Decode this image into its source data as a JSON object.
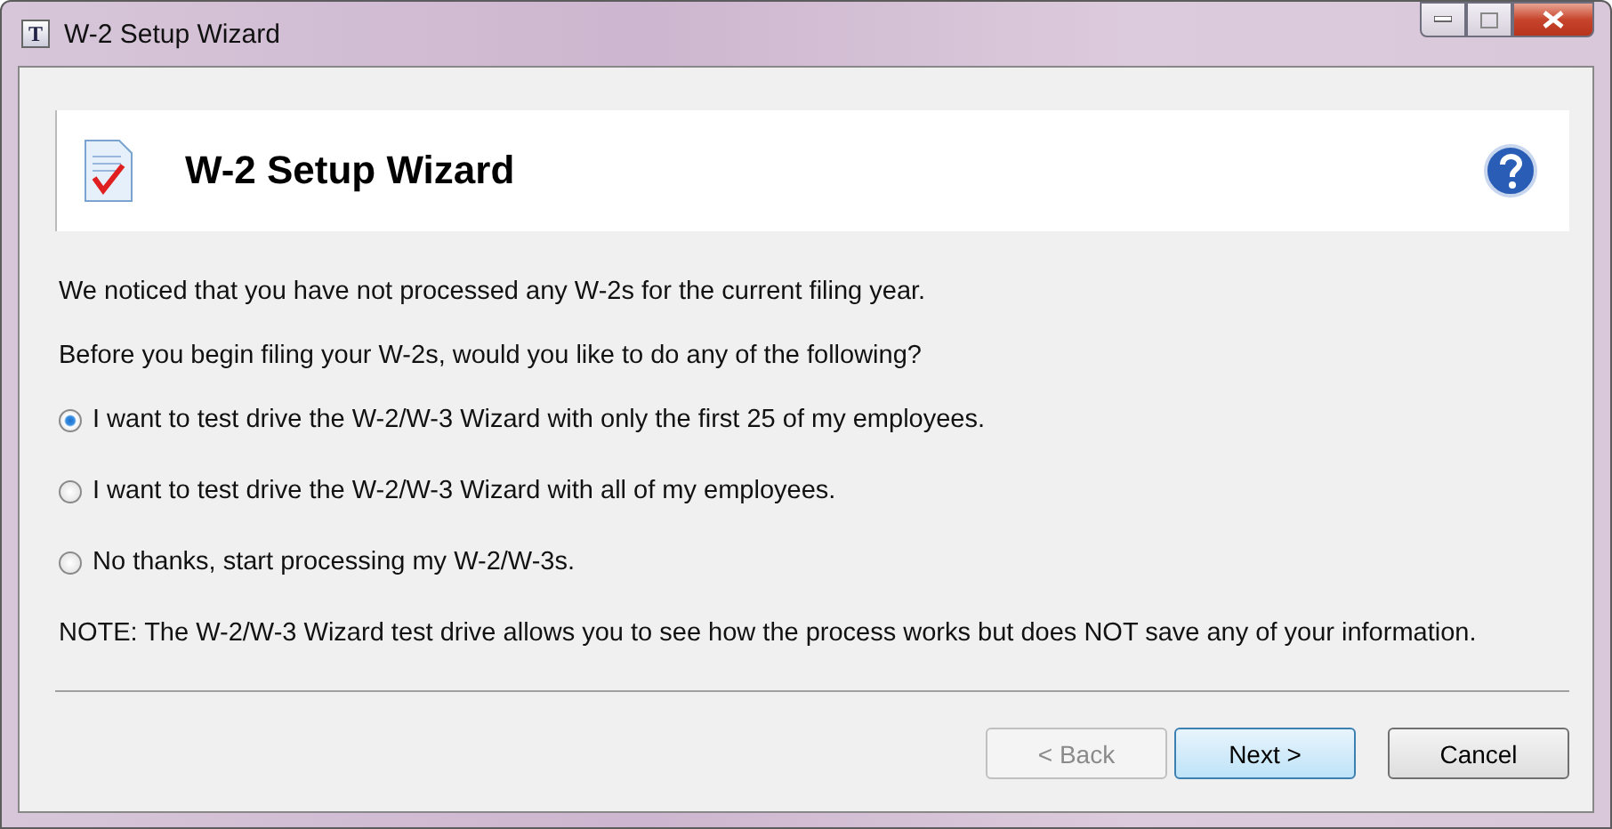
{
  "window": {
    "title": "W-2 Setup Wizard",
    "app_icon_letter": "T"
  },
  "header": {
    "title": "W-2 Setup Wizard"
  },
  "intro": "We noticed that you have not processed any W-2s for the current filing year.",
  "question": "Before you begin filing your W-2s, would you like to do any of the following?",
  "options": [
    {
      "label": "I want to test drive the W-2/W-3 Wizard with only the first 25 of my employees.",
      "selected": true
    },
    {
      "label": "I want to test drive the W-2/W-3 Wizard with all of my employees.",
      "selected": false
    },
    {
      "label": "No thanks, start processing my W-2/W-3s.",
      "selected": false
    }
  ],
  "note": "NOTE: The W-2/W-3 Wizard test drive allows you to see how the process works but does NOT save any of your information.",
  "buttons": [
    {
      "label": "< Back",
      "disabled": true,
      "default": false
    },
    {
      "label": "Next >",
      "disabled": false,
      "default": true
    },
    {
      "label": "Cancel",
      "disabled": false,
      "default": false
    }
  ]
}
